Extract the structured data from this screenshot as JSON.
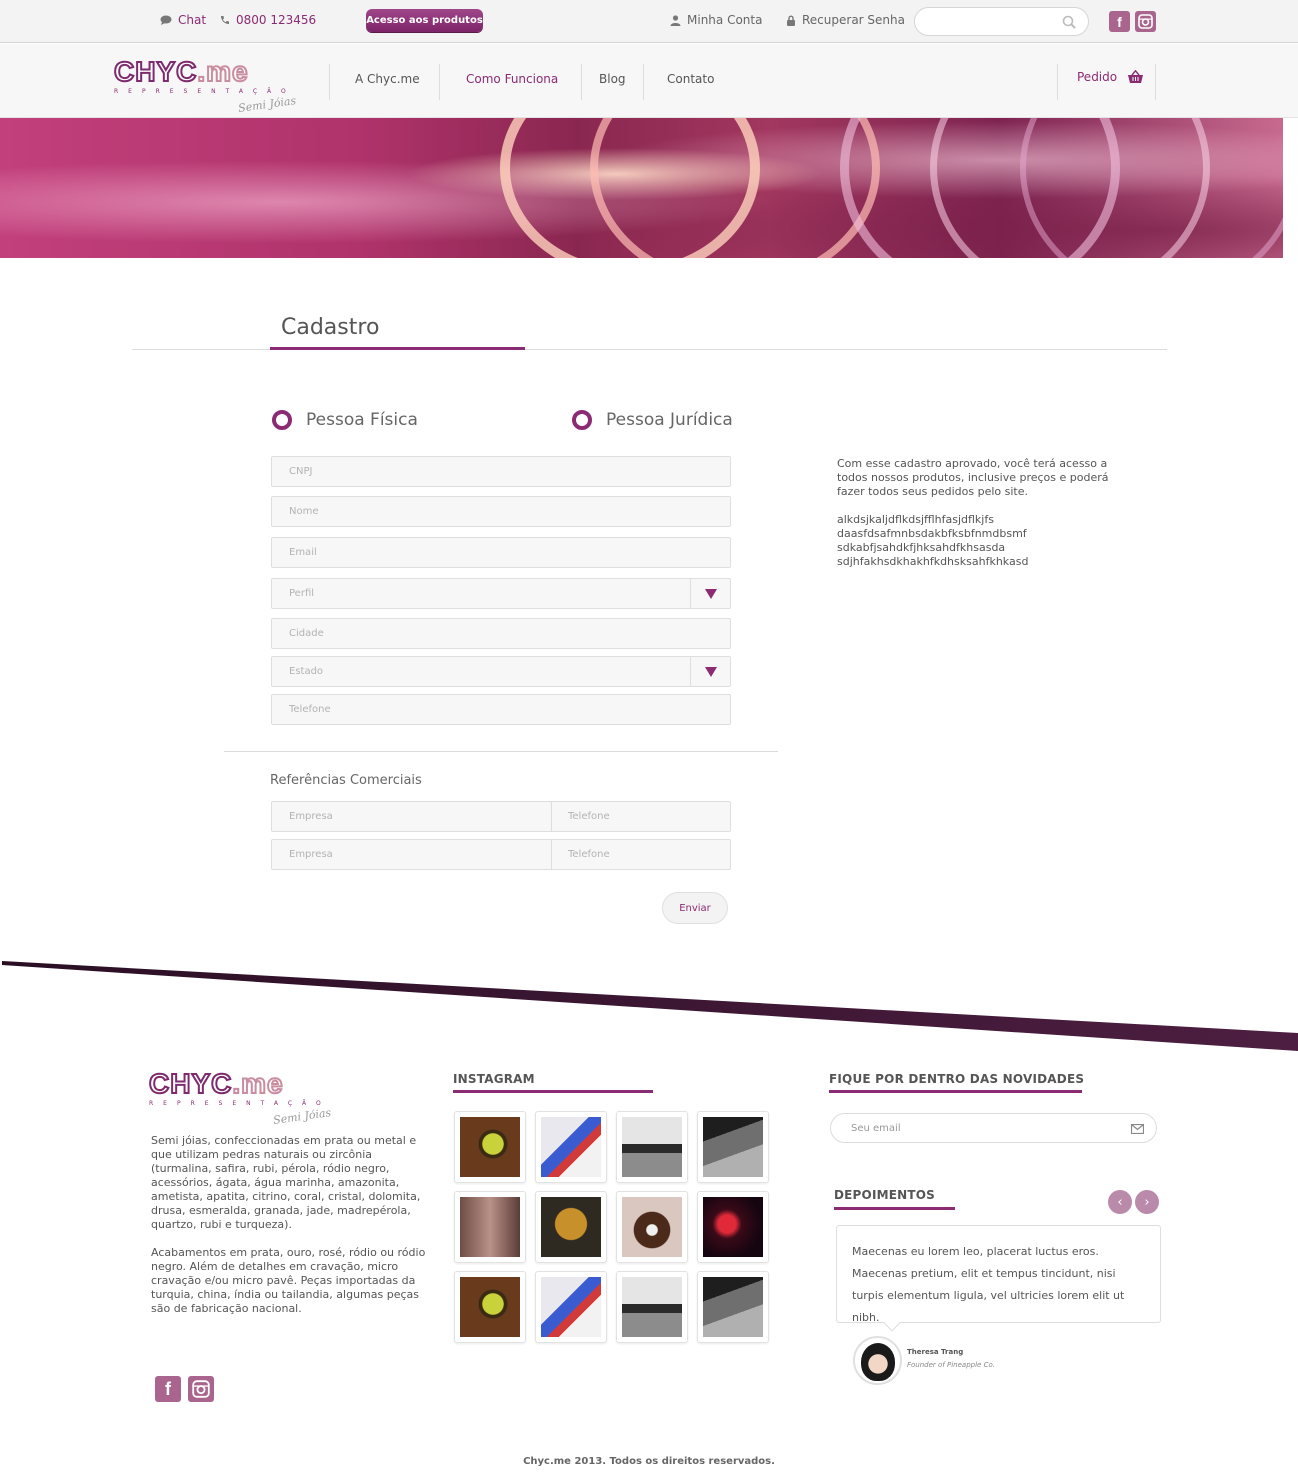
{
  "topbar": {
    "chat_label": "Chat",
    "phone": "0800 123456",
    "acesso_button": "Acesso aos produtos",
    "minha_conta": "Minha Conta",
    "recuperar_senha": "Recuperar Senha",
    "search_placeholder": "",
    "facebook_icon": "f",
    "instagram_icon": "◘"
  },
  "brand": {
    "logo_main": "CHYC",
    "logo_accent": ".me",
    "logo_subtitle": "REPRESENTAÇÃO",
    "logo_script": "Semi Jóias"
  },
  "nav": {
    "items": [
      {
        "label": "A Chyc.me",
        "active": false
      },
      {
        "label": "Como Funciona",
        "active": true
      },
      {
        "label": "Blog",
        "active": false
      },
      {
        "label": "Contato",
        "active": false
      }
    ],
    "pedido": "Pedido"
  },
  "form": {
    "title": "Cadastro",
    "radio_fisica": "Pessoa Física",
    "radio_juridica": "Pessoa Jurídica",
    "fields": {
      "cnpj": "CNPJ",
      "nome": "Nome",
      "email": "Email",
      "perfil": "Perfil",
      "cidade": "Cidade",
      "estado": "Estado",
      "telefone": "Telefone"
    },
    "referencias_title": "Referências Comerciais",
    "referencias": [
      {
        "empresa": "Empresa",
        "telefone": "Telefone"
      },
      {
        "empresa": "Empresa",
        "telefone": "Telefone"
      }
    ],
    "submit": "Enviar"
  },
  "side": {
    "paragraph1": "Com esse cadastro aprovado, você terá acesso a todos nossos produtos, inclusive preços e poderá fazer todos seus pedidos pelo site.",
    "paragraph2_lines": [
      "alkdsjkaljdflkdsjfflhfasjdflkjfs",
      "daasfdsafmnbsdakbfksbfnmdbsmf",
      "sdkabfjsahdkfjhksahdfkhsasda",
      "sdjhfakhsdkhakhfkdhsksahfkhkasd"
    ]
  },
  "footer": {
    "about_p1": "Semi jóias, confeccionadas em prata ou metal e que utilizam pedras naturais ou zircônia (turmalina, safira, rubi, pérola, ródio negro, acessórios, ágata, água marinha, amazonita, ametista, apatita, citrino, coral, cristal, dolomita, drusa, esmeralda, granada, jade, madrepérola, quartzo, rubi e turqueza).",
    "about_p2": "Acabamentos em prata, ouro, rosé, ródio ou ródio negro. Além de detalhes em cravação, micro cravação e/ou micro pavê. Peças importadas da turquia, china, índia ou tailandia, algumas peças são de fabricação nacional.",
    "instagram_title": "INSTAGRAM",
    "newsletter_title": "FIQUE POR DENTRO DAS NOVIDADES",
    "newsletter_placeholder": "Seu email",
    "depoimentos_title": "DEPOIMENTOS",
    "testimonial_text": "Maecenas eu lorem leo, placerat luctus eros. Maecenas pretium, elit et tempus tincidunt, nisi turpis elementum ligula, vel ultricies lorem elit ut nibh.",
    "author_name": "Theresa Trang",
    "author_role": "Founder of Pineapple Co.",
    "copyright": "Chyc.me 2013. Todos os direitos reservados."
  },
  "colors": {
    "accent": "#8b2b74",
    "footer_band": "#4a1a3c"
  }
}
